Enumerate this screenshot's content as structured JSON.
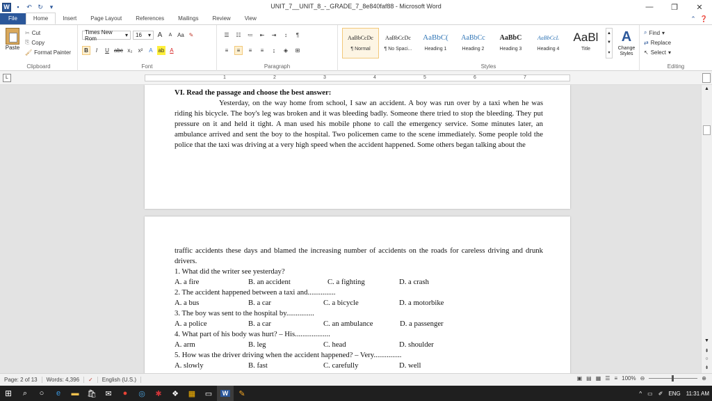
{
  "window": {
    "title": "UNIT_7__UNIT_8_-_GRADE_7_8e840faf88 - Microsoft Word",
    "minimize": "—",
    "restore": "❐",
    "close": "✕"
  },
  "qat": {
    "logo": "W"
  },
  "tabs": [
    "File",
    "Home",
    "Insert",
    "Page Layout",
    "References",
    "Mailings",
    "Review",
    "View"
  ],
  "ribbon": {
    "clipboard": {
      "paste": "Paste",
      "cut": "Cut",
      "copy": "Copy",
      "format_painter": "Format Painter",
      "label": "Clipboard"
    },
    "font": {
      "name": "Times New Rom",
      "size": "16",
      "grow": "A",
      "shrink": "A",
      "case": "Aa",
      "bold": "B",
      "italic": "I",
      "underline": "U",
      "strike": "abc",
      "sub": "x₂",
      "sup": "x²",
      "label": "Font"
    },
    "paragraph": {
      "label": "Paragraph",
      "pilcrow": "¶"
    },
    "styles": {
      "label": "Styles",
      "items": [
        {
          "preview": "AaBbCcDc",
          "name": "¶ Normal"
        },
        {
          "preview": "AaBbCcDc",
          "name": "¶ No Spaci..."
        },
        {
          "preview": "AaBbC(",
          "name": "Heading 1"
        },
        {
          "preview": "AaBbCc",
          "name": "Heading 2"
        },
        {
          "preview": "AaBbC",
          "name": "Heading 3"
        },
        {
          "preview": "AaBbCcL",
          "name": "Heading 4"
        },
        {
          "preview": "AaBl",
          "name": "Title"
        }
      ],
      "change_styles": "Change Styles"
    },
    "editing": {
      "find": "Find",
      "replace": "Replace",
      "select": "Select",
      "label": "Editing"
    }
  },
  "ruler": {
    "numbers": [
      "1",
      "2",
      "3",
      "4",
      "5",
      "6",
      "7"
    ]
  },
  "page1": {
    "heading": "VI. Read the passage and choose the best answer:",
    "paragraph": "Yesterday, on the way home from school, I saw an accident. A boy was run over by a taxi when he was riding his bicycle. The boy's leg was broken and it was bleeding badly. Someone there tried to stop the bleeding. They put pressure on it and held it tight. A man used his mobile phone to call the emergency service. Some minutes later, an ambulance arrived and sent the boy to the hospital. Two policemen came to the scene immediately. Some people told the police that the taxi was driving at a very high speed when the accident happened. Some others began talking about the"
  },
  "page2": {
    "continuation": "traffic accidents these days and blamed the increasing number of accidents on the roads for careless driving and drunk drivers.",
    "questions": [
      {
        "q": "1. What did the writer see yesterday?",
        "options": [
          "A. a fire",
          "B. an accident",
          "C. a fighting",
          "D. a crash"
        ]
      },
      {
        "q": "2. The accident happened between a taxi and...............",
        "options": [
          "A. a bus",
          "B. a car",
          "C. a bicycle",
          "D. a motorbike"
        ]
      },
      {
        "q": "3. The boy was sent to the hospital by...............",
        "options": [
          "A. a police",
          "B. a car",
          "C. an ambulance",
          "D. a passenger"
        ]
      },
      {
        "q": "4. What part of his body was hurt? – His...................",
        "options": [
          "A. arm",
          "B. leg",
          "C. head",
          "D. shoulder"
        ]
      },
      {
        "q": "5. How was the driver driving when the accident happened? – Very...............",
        "options": [
          "A. slowly",
          "B. fast",
          "C. carefully",
          "D. well"
        ]
      }
    ]
  },
  "status": {
    "page": "Page: 2 of 13",
    "words": "Words: 4,396",
    "language": "English (U.S.)",
    "zoom": "100%"
  },
  "taskbar": {
    "lang": "ENG",
    "time": "11:31 AM"
  }
}
